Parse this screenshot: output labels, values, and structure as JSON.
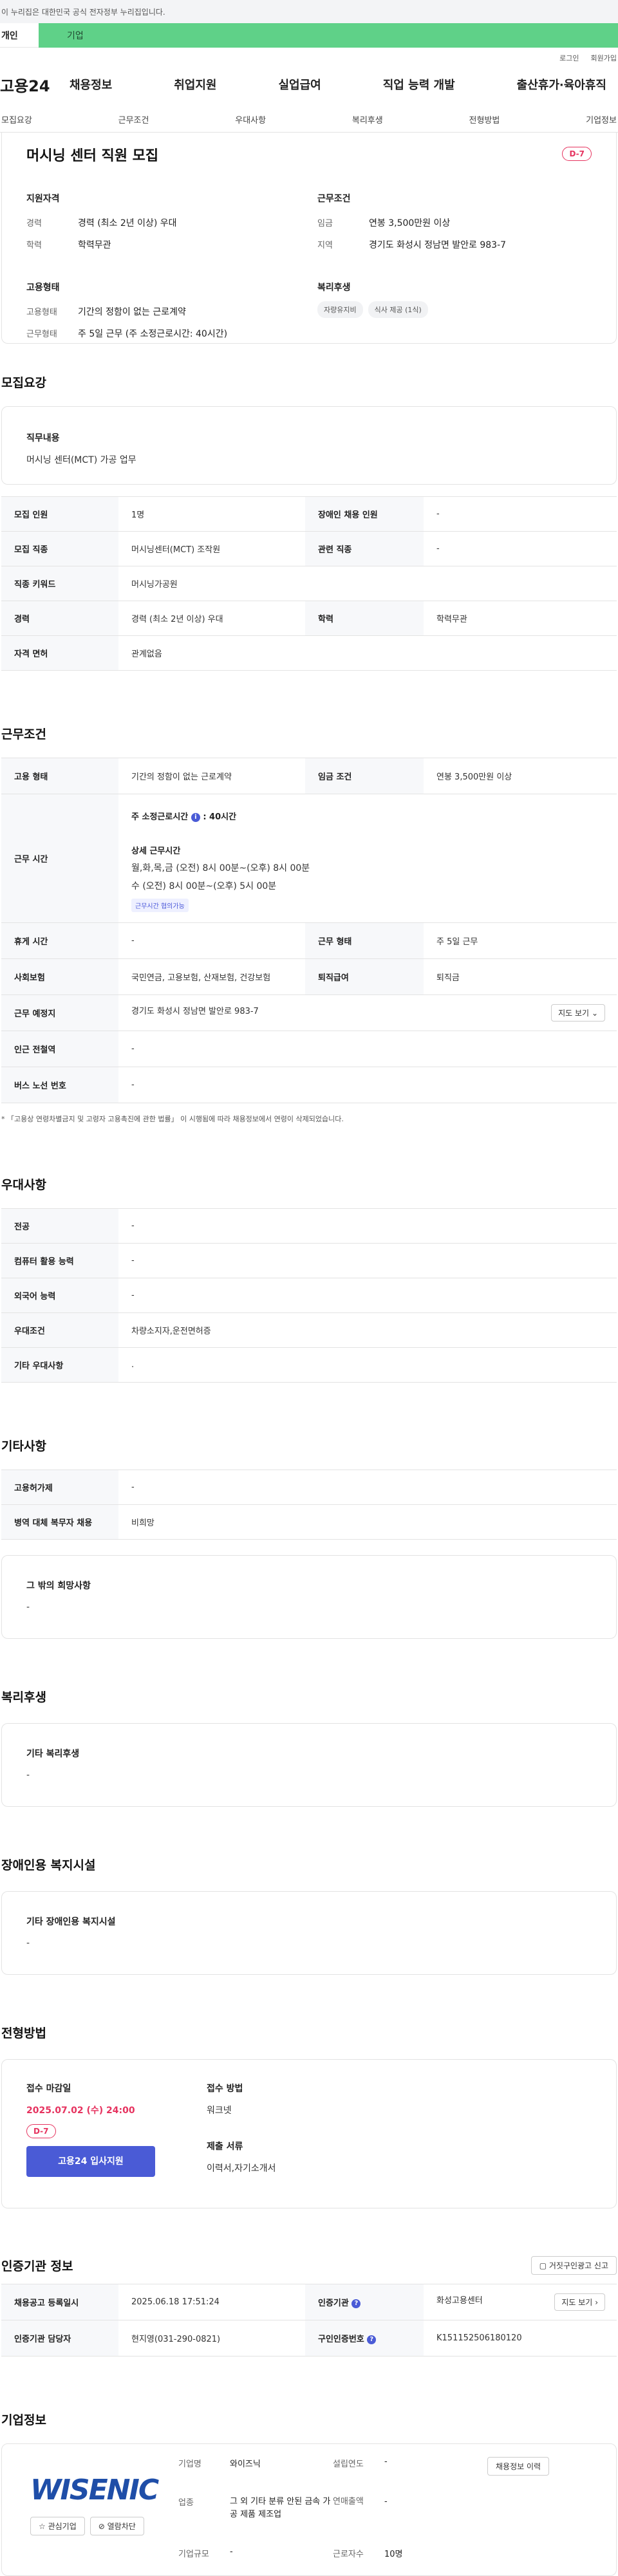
{
  "gov_banner": "이 누리집은 대한민국 공식 전자정부 누리집입니다.",
  "type_tabs": {
    "individual": "개인",
    "enterprise": "기업"
  },
  "util": {
    "login": "로그인",
    "join": "회원가입"
  },
  "gnb": {
    "logo": "고용24",
    "menu": [
      "채용정보",
      "취업지원",
      "실업급여",
      "직업 능력 개발",
      "출산휴가·육아휴직"
    ]
  },
  "subnav": [
    "모집요강",
    "근무조건",
    "우대사항",
    "복리후생",
    "전형방법",
    "기업정보"
  ],
  "summary": {
    "title": "머시닝 센터 직원 모집",
    "dday": "D-7",
    "qualification": {
      "heading": "지원자격",
      "career_label": "경력",
      "career": "경력 (최소 2년 이상) 우대",
      "edu_label": "학력",
      "edu": "학력무관"
    },
    "conditions": {
      "heading": "근무조건",
      "wage_label": "임금",
      "wage": "연봉 3,500만원 이상",
      "region_label": "지역",
      "region": "경기도 화성시 정남면 발안로 983-7"
    },
    "employment": {
      "heading": "고용형태",
      "type_label": "고용형태",
      "type": "기간의 정함이 없는 근로계약",
      "shape_label": "근무형태",
      "shape": "주 5일 근무 (주 소정근로시간: 40시간)"
    },
    "welfare": {
      "heading": "복리후생",
      "chips": [
        "자량유지비",
        "식사 제공 (1식)"
      ]
    }
  },
  "recruit": {
    "heading": "모집요강",
    "duty_title": "직무내용",
    "duty": "머시닝 센터(MCT) 가공 업무",
    "rows": {
      "count_k": "모집 인원",
      "count_v": "1명",
      "disabled_k": "장애인 채용 인원",
      "disabled_v": "-",
      "job_k": "모집 직종",
      "job_v": "머시닝센터(MCT) 조작원",
      "related_k": "관련 직종",
      "related_v": "-",
      "keyword_k": "직종 키워드",
      "keyword_v": "머시닝가공원",
      "career_k": "경력",
      "career_v": "경력 (최소 2년 이상) 우대",
      "edu_k": "학력",
      "edu_v": "학력무관",
      "license_k": "자격 면허",
      "license_v": "관계없음"
    }
  },
  "work": {
    "heading": "근무조건",
    "type_k": "고용 형태",
    "type_v": "기간의 정함이 없는 근로계약",
    "wage_k": "임금 조건",
    "wage_v": "연봉 3,500만원 이상",
    "hours_k": "근무 시간",
    "std_hours_label": "주 소정근로시간",
    "std_hours_value": ": 40시간",
    "detail_label": "상세 근무시간",
    "detail_line1": "월,화,목,금 (오전) 8시 00분~(오후) 8시 00분",
    "detail_line2": "수 (오전) 8시 00분~(오후) 5시 00분",
    "negotiable": "근무시간 협의가능",
    "rest_k": "휴게 시간",
    "rest_v": "-",
    "shape_k": "근무 형태",
    "shape_v": "주 5일 근무",
    "insurance_k": "사회보험",
    "insurance_v": "국민연금, 고용보험, 산재보험, 건강보험",
    "severance_k": "퇴직급여",
    "severance_v": "퇴직금",
    "place_k": "근무 예정지",
    "place_v": "경기도 화성시 정남면 발안로 983-7",
    "map_btn": "지도 보기",
    "subway_k": "인근 전철역",
    "subway_v": "-",
    "bus_k": "버스 노선 번호",
    "bus_v": "-",
    "note": "「고용상 연령차별금지 및 고령자 고용촉진에 관한 법률」 이 시행됨에 따라 채용정보에서 연령이 삭제되었습니다."
  },
  "pref": {
    "heading": "우대사항",
    "major_k": "전공",
    "major_v": "-",
    "pc_k": "컴퓨터 활용 능력",
    "pc_v": "-",
    "lang_k": "외국어 능력",
    "lang_v": "-",
    "cond_k": "우대조건",
    "cond_v": "차량소지자,운전면허증",
    "etc_k": "기타 우대사항",
    "etc_v": "."
  },
  "etc": {
    "heading": "기타사항",
    "permit_k": "고용허가제",
    "permit_v": "-",
    "military_k": "병역 대체 복무자 채용",
    "military_v": "비희망",
    "wish_title": "그 밖의 희망사항",
    "wish_v": "-"
  },
  "welfare": {
    "heading": "복리후생",
    "title": "기타 복리후생",
    "value": "-"
  },
  "facility": {
    "heading": "장애인용 복지시설",
    "title": "기타 장애인용 복지시설",
    "value": "-"
  },
  "screening": {
    "heading": "전형방법",
    "deadline_label": "접수 마감일",
    "deadline": "2025.07.02 (수) 24:00",
    "dday": "D-7",
    "apply": "고용24 입사지원",
    "method_label": "접수 방법",
    "method": "워크넷",
    "docs_label": "제출 서류",
    "docs": "이력서,자기소개서"
  },
  "agency": {
    "heading": "인증기관 정보",
    "report_btn": "거짓구인광고 신고",
    "reg_k": "채용공고 등록일시",
    "reg_v": "2025.06.18 17:51:24",
    "org_k": "인증기관",
    "org_v": "화성고용센터",
    "map_btn": "지도 보기",
    "staff_k": "인증기관 담당자",
    "staff_v": "현지영(031-290-0821)",
    "no_k": "구인인증번호",
    "no_v": "K151152506180120"
  },
  "company": {
    "heading": "기업정보",
    "logo": "WISENIC",
    "fav_btn": "관심기업",
    "block_btn": "열람차단",
    "name_k": "기업명",
    "name_v": "와이즈닉",
    "year_k": "설립연도",
    "year_v": "-",
    "history_btn": "채용정보 이력",
    "industry_k": "업종",
    "industry_v": "그 외 기타 분류 안된 금속 가공 제품 제조업",
    "sales_k": "연매출액",
    "sales_v": "-",
    "staff_k": "근로자수",
    "staff_v": "10명",
    "size_k": "기업규모",
    "size_v": "-"
  }
}
